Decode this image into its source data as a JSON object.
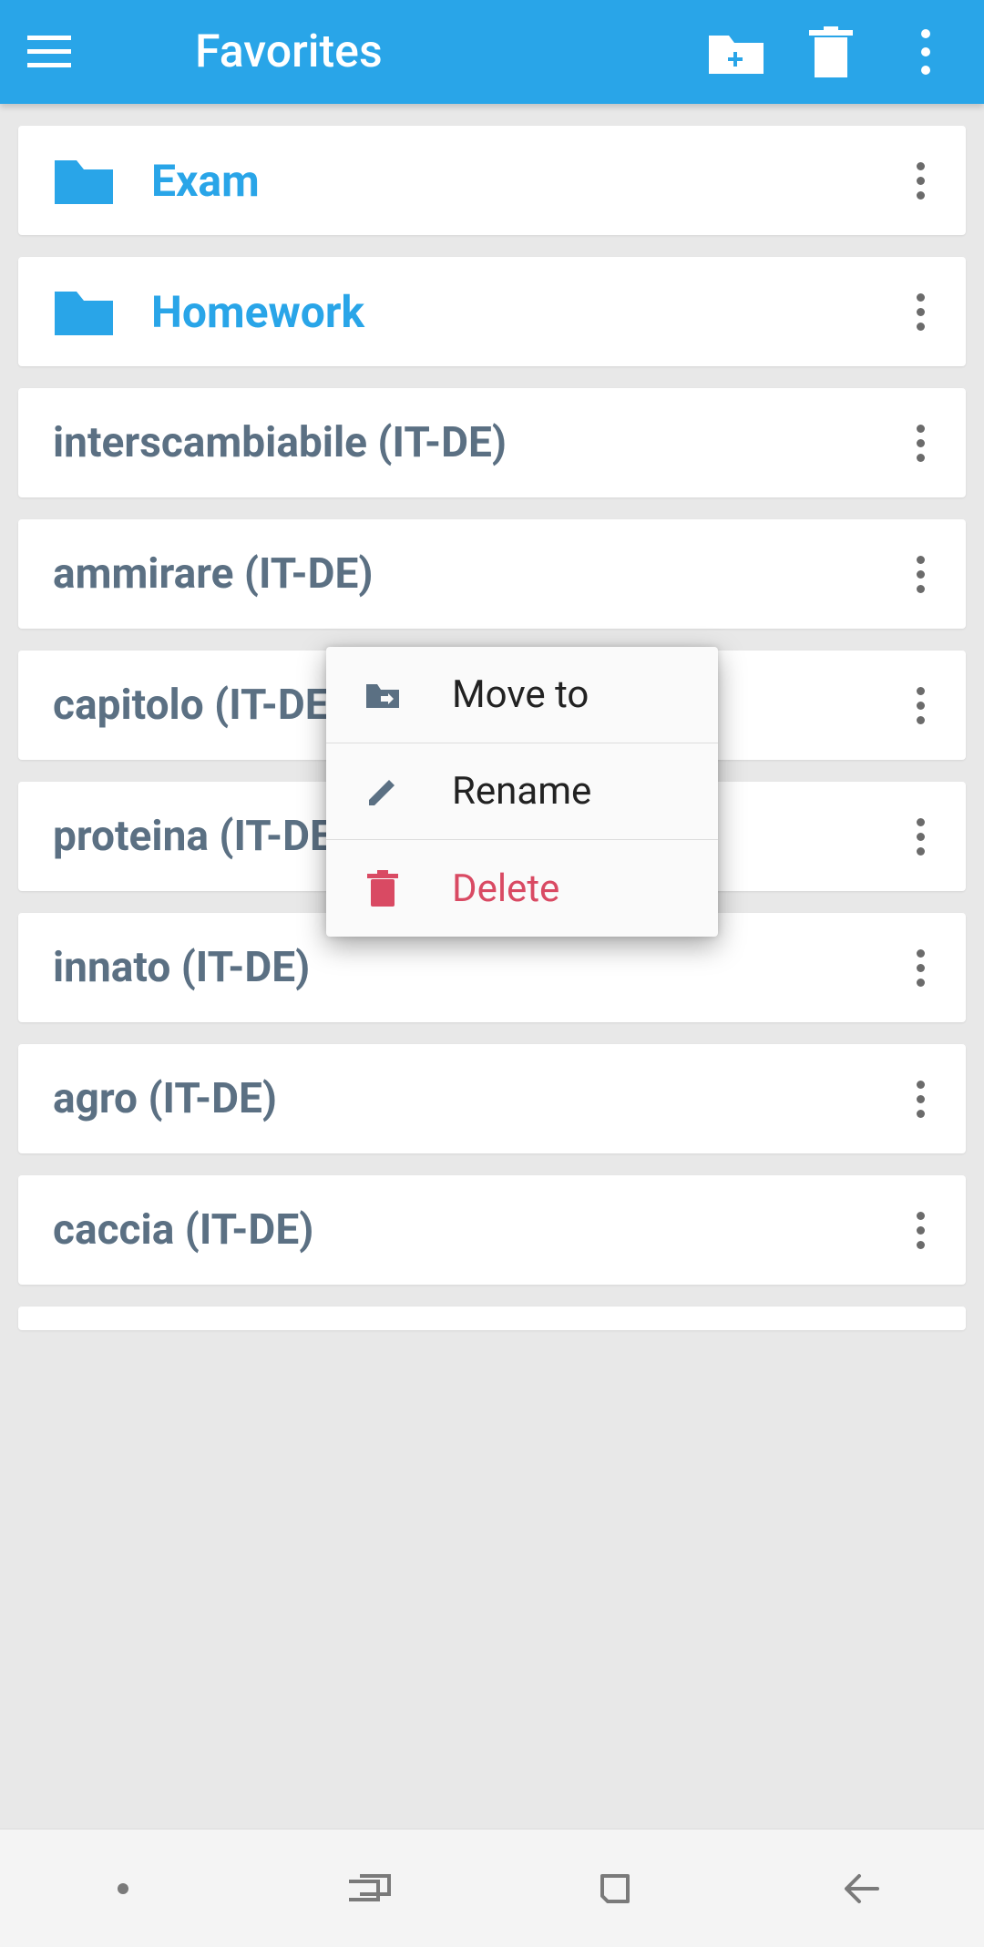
{
  "appbar": {
    "title": "Favorites"
  },
  "folders": [
    {
      "label": "Exam"
    },
    {
      "label": "Homework"
    }
  ],
  "words": [
    {
      "label": "interscambiabile (IT-DE)"
    },
    {
      "label": "ammirare (IT-DE)"
    },
    {
      "label": "capitolo (IT-DE)"
    },
    {
      "label": "proteina (IT-DE)"
    },
    {
      "label": "innato (IT-DE)"
    },
    {
      "label": "agro (IT-DE)"
    },
    {
      "label": "caccia (IT-DE)"
    }
  ],
  "popup": {
    "move": "Move to",
    "rename": "Rename",
    "delete": "Delete"
  }
}
